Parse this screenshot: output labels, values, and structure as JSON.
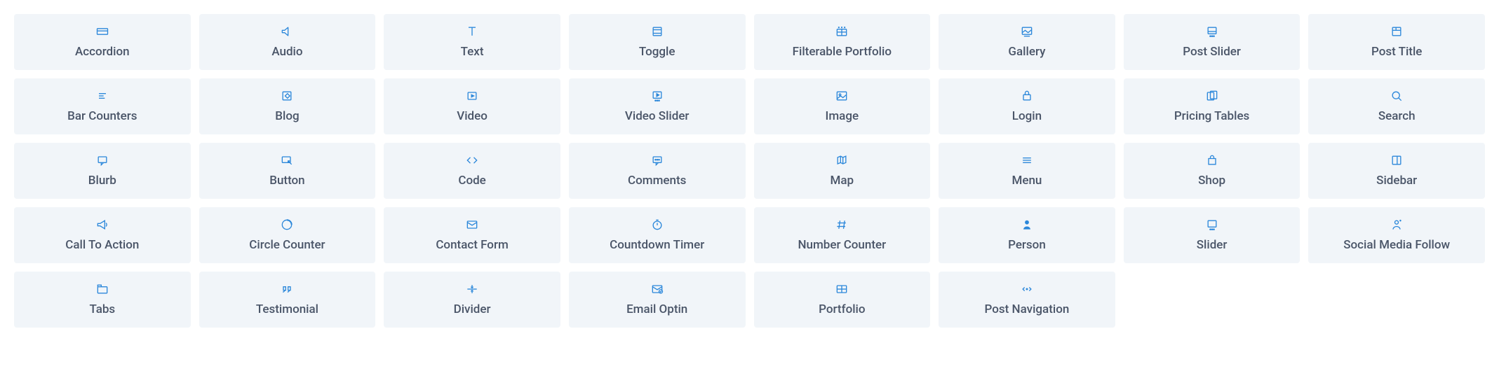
{
  "modules": [
    {
      "id": "accordion",
      "label": "Accordion",
      "icon": "accordion"
    },
    {
      "id": "audio",
      "label": "Audio",
      "icon": "audio"
    },
    {
      "id": "text",
      "label": "Text",
      "icon": "text"
    },
    {
      "id": "toggle",
      "label": "Toggle",
      "icon": "toggle"
    },
    {
      "id": "filterable-portfolio",
      "label": "Filterable Portfolio",
      "icon": "grid-dots"
    },
    {
      "id": "gallery",
      "label": "Gallery",
      "icon": "gallery"
    },
    {
      "id": "post-slider",
      "label": "Post Slider",
      "icon": "post-slider"
    },
    {
      "id": "post-title",
      "label": "Post Title",
      "icon": "post-title"
    },
    {
      "id": "bar-counters",
      "label": "Bar Counters",
      "icon": "bars"
    },
    {
      "id": "blog",
      "label": "Blog",
      "icon": "blog"
    },
    {
      "id": "video",
      "label": "Video",
      "icon": "video"
    },
    {
      "id": "video-slider",
      "label": "Video Slider",
      "icon": "video-slider"
    },
    {
      "id": "image",
      "label": "Image",
      "icon": "image"
    },
    {
      "id": "login",
      "label": "Login",
      "icon": "login"
    },
    {
      "id": "pricing-tables",
      "label": "Pricing Tables",
      "icon": "pricing"
    },
    {
      "id": "search",
      "label": "Search",
      "icon": "search"
    },
    {
      "id": "blurb",
      "label": "Blurb",
      "icon": "blurb"
    },
    {
      "id": "button",
      "label": "Button",
      "icon": "button"
    },
    {
      "id": "code",
      "label": "Code",
      "icon": "code"
    },
    {
      "id": "comments",
      "label": "Comments",
      "icon": "comments"
    },
    {
      "id": "map",
      "label": "Map",
      "icon": "map"
    },
    {
      "id": "menu",
      "label": "Menu",
      "icon": "menu"
    },
    {
      "id": "shop",
      "label": "Shop",
      "icon": "shop"
    },
    {
      "id": "sidebar",
      "label": "Sidebar",
      "icon": "sidebar"
    },
    {
      "id": "call-to-action",
      "label": "Call To Action",
      "icon": "megaphone"
    },
    {
      "id": "circle-counter",
      "label": "Circle Counter",
      "icon": "circle-counter"
    },
    {
      "id": "contact-form",
      "label": "Contact Form",
      "icon": "envelope"
    },
    {
      "id": "countdown-timer",
      "label": "Countdown Timer",
      "icon": "timer"
    },
    {
      "id": "number-counter",
      "label": "Number Counter",
      "icon": "hash"
    },
    {
      "id": "person",
      "label": "Person",
      "icon": "person"
    },
    {
      "id": "slider",
      "label": "Slider",
      "icon": "slider"
    },
    {
      "id": "social-media-follow",
      "label": "Social Media Follow",
      "icon": "social"
    },
    {
      "id": "tabs",
      "label": "Tabs",
      "icon": "tabs"
    },
    {
      "id": "testimonial",
      "label": "Testimonial",
      "icon": "quote"
    },
    {
      "id": "divider",
      "label": "Divider",
      "icon": "divider"
    },
    {
      "id": "email-optin",
      "label": "Email Optin",
      "icon": "email-optin"
    },
    {
      "id": "portfolio",
      "label": "Portfolio",
      "icon": "portfolio"
    },
    {
      "id": "post-navigation",
      "label": "Post Navigation",
      "icon": "post-nav"
    }
  ]
}
